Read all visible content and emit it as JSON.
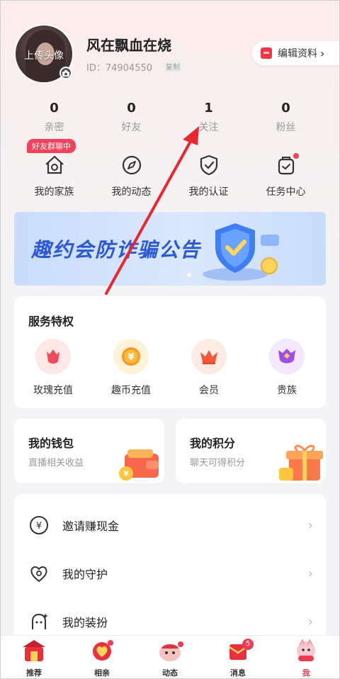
{
  "profile": {
    "avatar_label": "上传头像",
    "nickname": "风在飘血在烧",
    "id_text": "ID：74904550",
    "copy_label": "复制",
    "edit_label": "编辑资料"
  },
  "stats": [
    {
      "value": "0",
      "label": "亲密"
    },
    {
      "value": "0",
      "label": "好友"
    },
    {
      "value": "1",
      "label": "关注"
    },
    {
      "value": "0",
      "label": "粉丝"
    }
  ],
  "shortcuts": {
    "group_badge": "好友群聊中",
    "items": [
      {
        "label": "我的家族",
        "icon": "family-icon"
      },
      {
        "label": "我的动态",
        "icon": "compass-icon"
      },
      {
        "label": "我的认证",
        "icon": "shield-check-icon"
      },
      {
        "label": "任务中心",
        "icon": "task-bag-icon"
      }
    ]
  },
  "banner": {
    "text": "趣约会防诈骗公告"
  },
  "service": {
    "title": "服务特权",
    "items": [
      {
        "label": "玫瑰充值",
        "icon": "rose-icon"
      },
      {
        "label": "趣币充值",
        "icon": "yuan-coin-icon"
      },
      {
        "label": "会员",
        "icon": "crown-icon"
      },
      {
        "label": "贵族",
        "icon": "noble-badge-icon"
      }
    ]
  },
  "wallet": {
    "title": "我的钱包",
    "subtitle": "直播相关收益"
  },
  "points": {
    "title": "我的积分",
    "subtitle": "聊天可得积分"
  },
  "menu": [
    {
      "label": "邀请赚现金",
      "icon": "yuan-circle-icon"
    },
    {
      "label": "我的守护",
      "icon": "heart-guard-icon"
    },
    {
      "label": "我的装扮",
      "icon": "dressup-icon"
    }
  ],
  "tabbar": [
    {
      "label": "推荐"
    },
    {
      "label": "相亲"
    },
    {
      "label": "动态"
    },
    {
      "label": "消息",
      "badge": "5"
    },
    {
      "label": "我"
    }
  ],
  "colors": {
    "accent": "#f23a52",
    "banner_text": "#2a58d6",
    "annotation_arrow": "#e8272f"
  }
}
